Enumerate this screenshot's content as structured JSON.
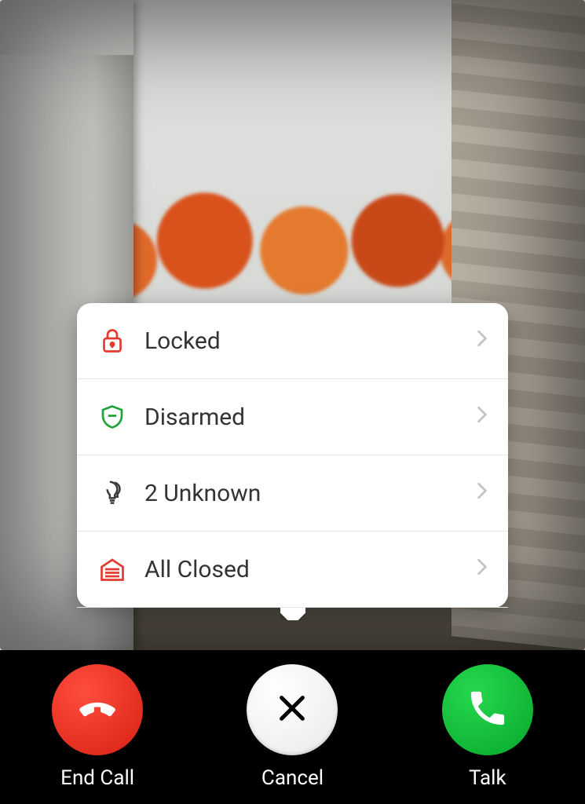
{
  "popover": {
    "items": [
      {
        "icon": "lock-icon",
        "label": "Locked",
        "color": "#e23b2e"
      },
      {
        "icon": "shield-icon",
        "label": "Disarmed",
        "color": "#1fa33a"
      },
      {
        "icon": "lightbulb-icon",
        "label": "2 Unknown",
        "color": "#3a3a3a"
      },
      {
        "icon": "garage-icon",
        "label": "All Closed",
        "color": "#e23b2e"
      }
    ]
  },
  "callbar": {
    "end_call_label": "End Call",
    "cancel_label": "Cancel",
    "talk_label": "Talk"
  }
}
